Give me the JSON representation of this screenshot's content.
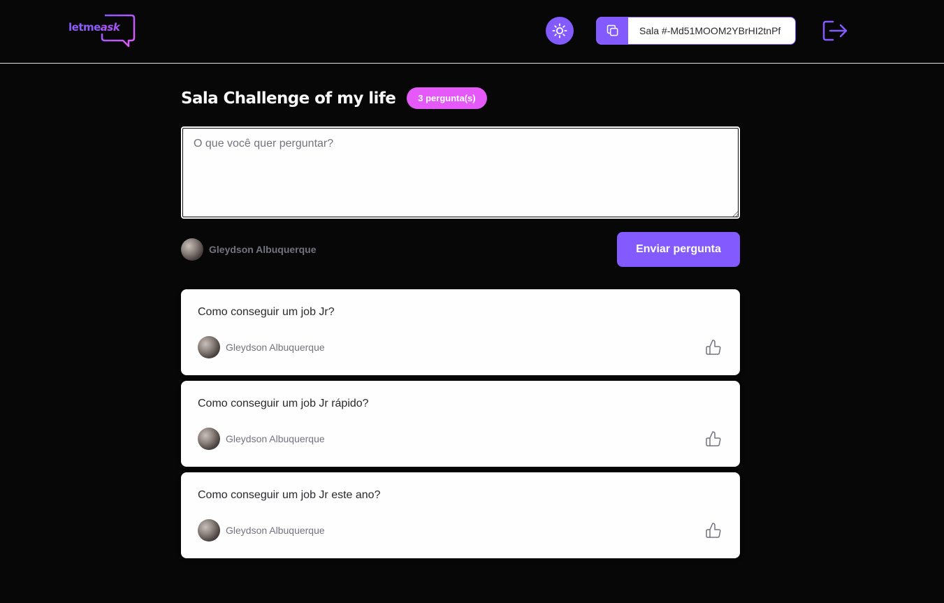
{
  "header": {
    "logo": {
      "part1": "letme",
      "part2": "ask"
    },
    "room_code_label": "Sala #-Md51MOOM2YBrHI2tnPf"
  },
  "room": {
    "title": "Sala Challenge of my life",
    "question_count": "3 pergunta(s)"
  },
  "form": {
    "placeholder": "O que você quer perguntar?",
    "user_name": "Gleydson Albuquerque",
    "submit_label": "Enviar pergunta"
  },
  "questions": [
    {
      "content": "Como conseguir um job Jr?",
      "author": "Gleydson Albuquerque"
    },
    {
      "content": "Como conseguir um job Jr rápido?",
      "author": "Gleydson Albuquerque"
    },
    {
      "content": "Como conseguir um job Jr este ano?",
      "author": "Gleydson Albuquerque"
    }
  ],
  "colors": {
    "background": "#070707",
    "primary": "#835afd",
    "badge": "#e559f9",
    "card": "#fefefe",
    "text_muted": "#737380"
  },
  "icons": [
    "sun-icon",
    "copy-icon",
    "logout-icon",
    "like-icon",
    "speech-bubble-icon"
  ]
}
